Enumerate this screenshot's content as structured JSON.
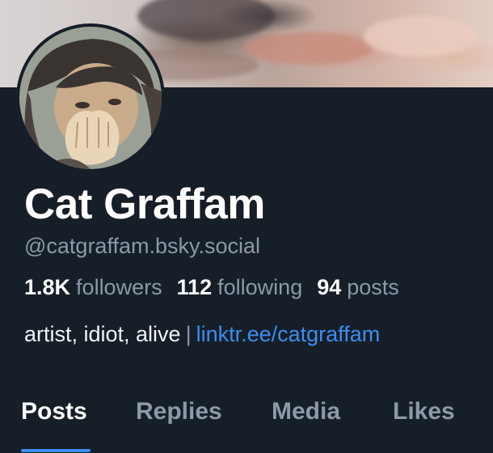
{
  "profile": {
    "display_name": "Cat Graffam",
    "handle": "@catgraffam.bsky.social",
    "bio_text": "artist, idiot, alive",
    "bio_separator": "|",
    "bio_link": "linktr.ee/catgraffam"
  },
  "stats": {
    "followers_count": "1.8K",
    "followers_label": "followers",
    "following_count": "112",
    "following_label": "following",
    "posts_count": "94",
    "posts_label": "posts"
  },
  "tabs": [
    {
      "label": "Posts",
      "active": true
    },
    {
      "label": "Replies",
      "active": false
    },
    {
      "label": "Media",
      "active": false
    },
    {
      "label": "Likes",
      "active": false
    }
  ],
  "colors": {
    "background": "#161e27",
    "link": "#3b8ef0",
    "muted_text": "#8c99a8",
    "primary_text": "#ffffff"
  }
}
